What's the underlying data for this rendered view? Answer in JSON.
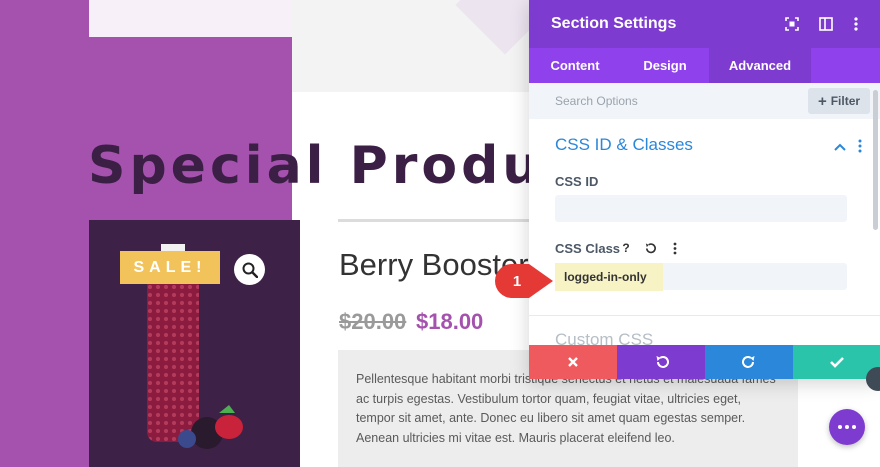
{
  "page": {
    "title": "Special Products",
    "product": {
      "sale_badge": "SALE!",
      "name": "Berry Booster",
      "old_price": "$20.00",
      "new_price": "$18.00",
      "description": "Pellentesque habitant morbi tristique senectus et netus et malesuada fames ac turpis egestas. Vestibulum tortor quam, feugiat vitae, ultricies eget, tempor sit amet, ante. Donec eu libero sit amet quam egestas semper. Aenean ultricies mi vitae est. Mauris placerat eleifend leo."
    }
  },
  "panel": {
    "title": "Section Settings",
    "tabs": [
      {
        "label": "Content",
        "active": false
      },
      {
        "label": "Design",
        "active": false
      },
      {
        "label": "Advanced",
        "active": true
      }
    ],
    "search_placeholder": "Search Options",
    "filter_label": "Filter",
    "section_title": "CSS ID & Classes",
    "css_id_label": "CSS ID",
    "css_id_value": "",
    "css_class_label": "CSS Class",
    "css_class_value": "logged-in-only",
    "next_section_title": "Custom CSS"
  },
  "annotation": {
    "number": "1"
  },
  "colors": {
    "purple_header": "#7e3bd0",
    "purple_tabs": "#8f42ec",
    "page_purple": "#a552ae",
    "cancel_red": "#ef5a5e",
    "undo_purple": "#7e3bd0",
    "redo_blue": "#2b87da",
    "save_green": "#29c4a9",
    "callout_red": "#e53935"
  }
}
